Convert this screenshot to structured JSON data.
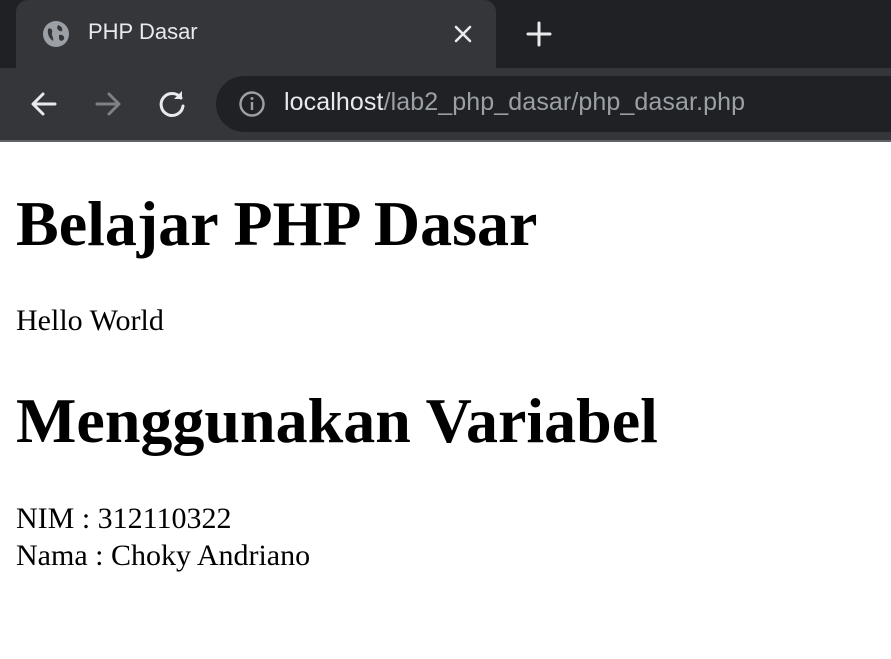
{
  "browser": {
    "tab": {
      "title": "PHP Dasar",
      "favicon": "globe-icon"
    },
    "address_bar": {
      "host": "localhost",
      "path": "/lab2_php_dasar/php_dasar.php"
    }
  },
  "page": {
    "heading1": "Belajar PHP Dasar",
    "text1": "Hello World",
    "heading2": "Menggunakan Variabel",
    "nim_line": "NIM : 312110322",
    "nama_line": "Nama : Choky Andriano"
  }
}
